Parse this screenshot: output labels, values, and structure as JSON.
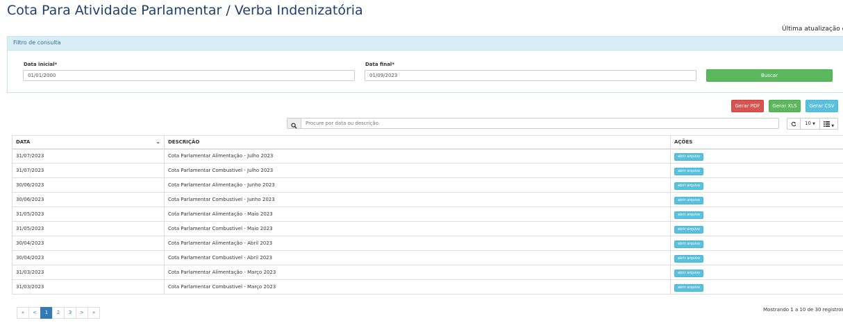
{
  "header": {
    "title": "Cota Para Atividade Parlamentar / Verba Indenizatória",
    "last_update": "Última atualização e"
  },
  "filter": {
    "title": "Filtro de consulta",
    "start_label": "Data inicial*",
    "start_value": "01/01/2000",
    "end_label": "Data final*",
    "end_value": "01/09/2023",
    "search_button": "Buscar"
  },
  "export": {
    "pdf": "Gerar PDF",
    "xls": "Gerar XLS",
    "csv": "Gerar CSV"
  },
  "toolbar": {
    "search_placeholder": "Procure por data ou descrição.",
    "page_size": "10",
    "search_icon": "search-icon",
    "refresh_icon": "refresh-icon",
    "columns_icon": "columns-icon"
  },
  "table": {
    "headers": [
      "DATA",
      "DESCRIÇÃO",
      "AÇÕES"
    ],
    "action_label": "abrir arquivo",
    "rows": [
      {
        "date": "31/07/2023",
        "desc": "Cota Parlamentar Alimentação - Julho 2023"
      },
      {
        "date": "31/07/2023",
        "desc": "Cota Parlamentar Combustivel - Julho 2023"
      },
      {
        "date": "30/06/2023",
        "desc": "Cota Parlamentar Alimentação - Junho 2023"
      },
      {
        "date": "30/06/2023",
        "desc": "Cota Parlamentar Combustivel - Junho 2023"
      },
      {
        "date": "31/05/2023",
        "desc": "Cota Parlamentar Alimentação - Maio 2023"
      },
      {
        "date": "31/05/2023",
        "desc": "Cota Parlamentar Combustivel - Maio 2023"
      },
      {
        "date": "30/04/2023",
        "desc": "Cota Parlamentar Alimentação - Abril 2023"
      },
      {
        "date": "30/04/2023",
        "desc": "Cota Parlamentar Combustivel - Abril 2023"
      },
      {
        "date": "31/03/2023",
        "desc": "Cota Parlamentar Alimentação - Março 2023"
      },
      {
        "date": "31/03/2023",
        "desc": "Cota Parlamentar Combustivel - Março 2023"
      }
    ]
  },
  "pagination": {
    "first": "«",
    "prev": "<",
    "pages": [
      "1",
      "2",
      "3"
    ],
    "next": ">",
    "last": "»",
    "current": "1",
    "showing": "Mostrando 1 a 10 de 30 registros"
  },
  "colors": {
    "title": "#1d3f6e",
    "primary": "#337ab7",
    "success": "#5cb85c",
    "danger": "#d9534f",
    "info": "#5bc0de"
  }
}
